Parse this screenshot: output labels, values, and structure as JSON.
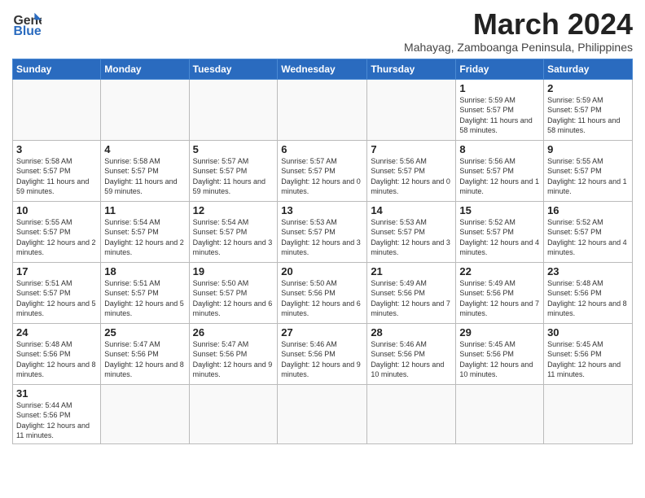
{
  "header": {
    "logo_line1": "General",
    "logo_line2": "Blue",
    "month_title": "March 2024",
    "location": "Mahayag, Zamboanga Peninsula, Philippines"
  },
  "weekdays": [
    "Sunday",
    "Monday",
    "Tuesday",
    "Wednesday",
    "Thursday",
    "Friday",
    "Saturday"
  ],
  "weeks": [
    [
      {
        "day": "",
        "info": ""
      },
      {
        "day": "",
        "info": ""
      },
      {
        "day": "",
        "info": ""
      },
      {
        "day": "",
        "info": ""
      },
      {
        "day": "",
        "info": ""
      },
      {
        "day": "1",
        "info": "Sunrise: 5:59 AM\nSunset: 5:57 PM\nDaylight: 11 hours\nand 58 minutes."
      },
      {
        "day": "2",
        "info": "Sunrise: 5:59 AM\nSunset: 5:57 PM\nDaylight: 11 hours\nand 58 minutes."
      }
    ],
    [
      {
        "day": "3",
        "info": "Sunrise: 5:58 AM\nSunset: 5:57 PM\nDaylight: 11 hours\nand 59 minutes."
      },
      {
        "day": "4",
        "info": "Sunrise: 5:58 AM\nSunset: 5:57 PM\nDaylight: 11 hours\nand 59 minutes."
      },
      {
        "day": "5",
        "info": "Sunrise: 5:57 AM\nSunset: 5:57 PM\nDaylight: 11 hours\nand 59 minutes."
      },
      {
        "day": "6",
        "info": "Sunrise: 5:57 AM\nSunset: 5:57 PM\nDaylight: 12 hours\nand 0 minutes."
      },
      {
        "day": "7",
        "info": "Sunrise: 5:56 AM\nSunset: 5:57 PM\nDaylight: 12 hours\nand 0 minutes."
      },
      {
        "day": "8",
        "info": "Sunrise: 5:56 AM\nSunset: 5:57 PM\nDaylight: 12 hours\nand 1 minute."
      },
      {
        "day": "9",
        "info": "Sunrise: 5:55 AM\nSunset: 5:57 PM\nDaylight: 12 hours\nand 1 minute."
      }
    ],
    [
      {
        "day": "10",
        "info": "Sunrise: 5:55 AM\nSunset: 5:57 PM\nDaylight: 12 hours\nand 2 minutes."
      },
      {
        "day": "11",
        "info": "Sunrise: 5:54 AM\nSunset: 5:57 PM\nDaylight: 12 hours\nand 2 minutes."
      },
      {
        "day": "12",
        "info": "Sunrise: 5:54 AM\nSunset: 5:57 PM\nDaylight: 12 hours\nand 3 minutes."
      },
      {
        "day": "13",
        "info": "Sunrise: 5:53 AM\nSunset: 5:57 PM\nDaylight: 12 hours\nand 3 minutes."
      },
      {
        "day": "14",
        "info": "Sunrise: 5:53 AM\nSunset: 5:57 PM\nDaylight: 12 hours\nand 3 minutes."
      },
      {
        "day": "15",
        "info": "Sunrise: 5:52 AM\nSunset: 5:57 PM\nDaylight: 12 hours\nand 4 minutes."
      },
      {
        "day": "16",
        "info": "Sunrise: 5:52 AM\nSunset: 5:57 PM\nDaylight: 12 hours\nand 4 minutes."
      }
    ],
    [
      {
        "day": "17",
        "info": "Sunrise: 5:51 AM\nSunset: 5:57 PM\nDaylight: 12 hours\nand 5 minutes."
      },
      {
        "day": "18",
        "info": "Sunrise: 5:51 AM\nSunset: 5:57 PM\nDaylight: 12 hours\nand 5 minutes."
      },
      {
        "day": "19",
        "info": "Sunrise: 5:50 AM\nSunset: 5:57 PM\nDaylight: 12 hours\nand 6 minutes."
      },
      {
        "day": "20",
        "info": "Sunrise: 5:50 AM\nSunset: 5:56 PM\nDaylight: 12 hours\nand 6 minutes."
      },
      {
        "day": "21",
        "info": "Sunrise: 5:49 AM\nSunset: 5:56 PM\nDaylight: 12 hours\nand 7 minutes."
      },
      {
        "day": "22",
        "info": "Sunrise: 5:49 AM\nSunset: 5:56 PM\nDaylight: 12 hours\nand 7 minutes."
      },
      {
        "day": "23",
        "info": "Sunrise: 5:48 AM\nSunset: 5:56 PM\nDaylight: 12 hours\nand 8 minutes."
      }
    ],
    [
      {
        "day": "24",
        "info": "Sunrise: 5:48 AM\nSunset: 5:56 PM\nDaylight: 12 hours\nand 8 minutes."
      },
      {
        "day": "25",
        "info": "Sunrise: 5:47 AM\nSunset: 5:56 PM\nDaylight: 12 hours\nand 8 minutes."
      },
      {
        "day": "26",
        "info": "Sunrise: 5:47 AM\nSunset: 5:56 PM\nDaylight: 12 hours\nand 9 minutes."
      },
      {
        "day": "27",
        "info": "Sunrise: 5:46 AM\nSunset: 5:56 PM\nDaylight: 12 hours\nand 9 minutes."
      },
      {
        "day": "28",
        "info": "Sunrise: 5:46 AM\nSunset: 5:56 PM\nDaylight: 12 hours\nand 10 minutes."
      },
      {
        "day": "29",
        "info": "Sunrise: 5:45 AM\nSunset: 5:56 PM\nDaylight: 12 hours\nand 10 minutes."
      },
      {
        "day": "30",
        "info": "Sunrise: 5:45 AM\nSunset: 5:56 PM\nDaylight: 12 hours\nand 11 minutes."
      }
    ],
    [
      {
        "day": "31",
        "info": "Sunrise: 5:44 AM\nSunset: 5:56 PM\nDaylight: 12 hours\nand 11 minutes."
      },
      {
        "day": "",
        "info": ""
      },
      {
        "day": "",
        "info": ""
      },
      {
        "day": "",
        "info": ""
      },
      {
        "day": "",
        "info": ""
      },
      {
        "day": "",
        "info": ""
      },
      {
        "day": "",
        "info": ""
      }
    ]
  ]
}
